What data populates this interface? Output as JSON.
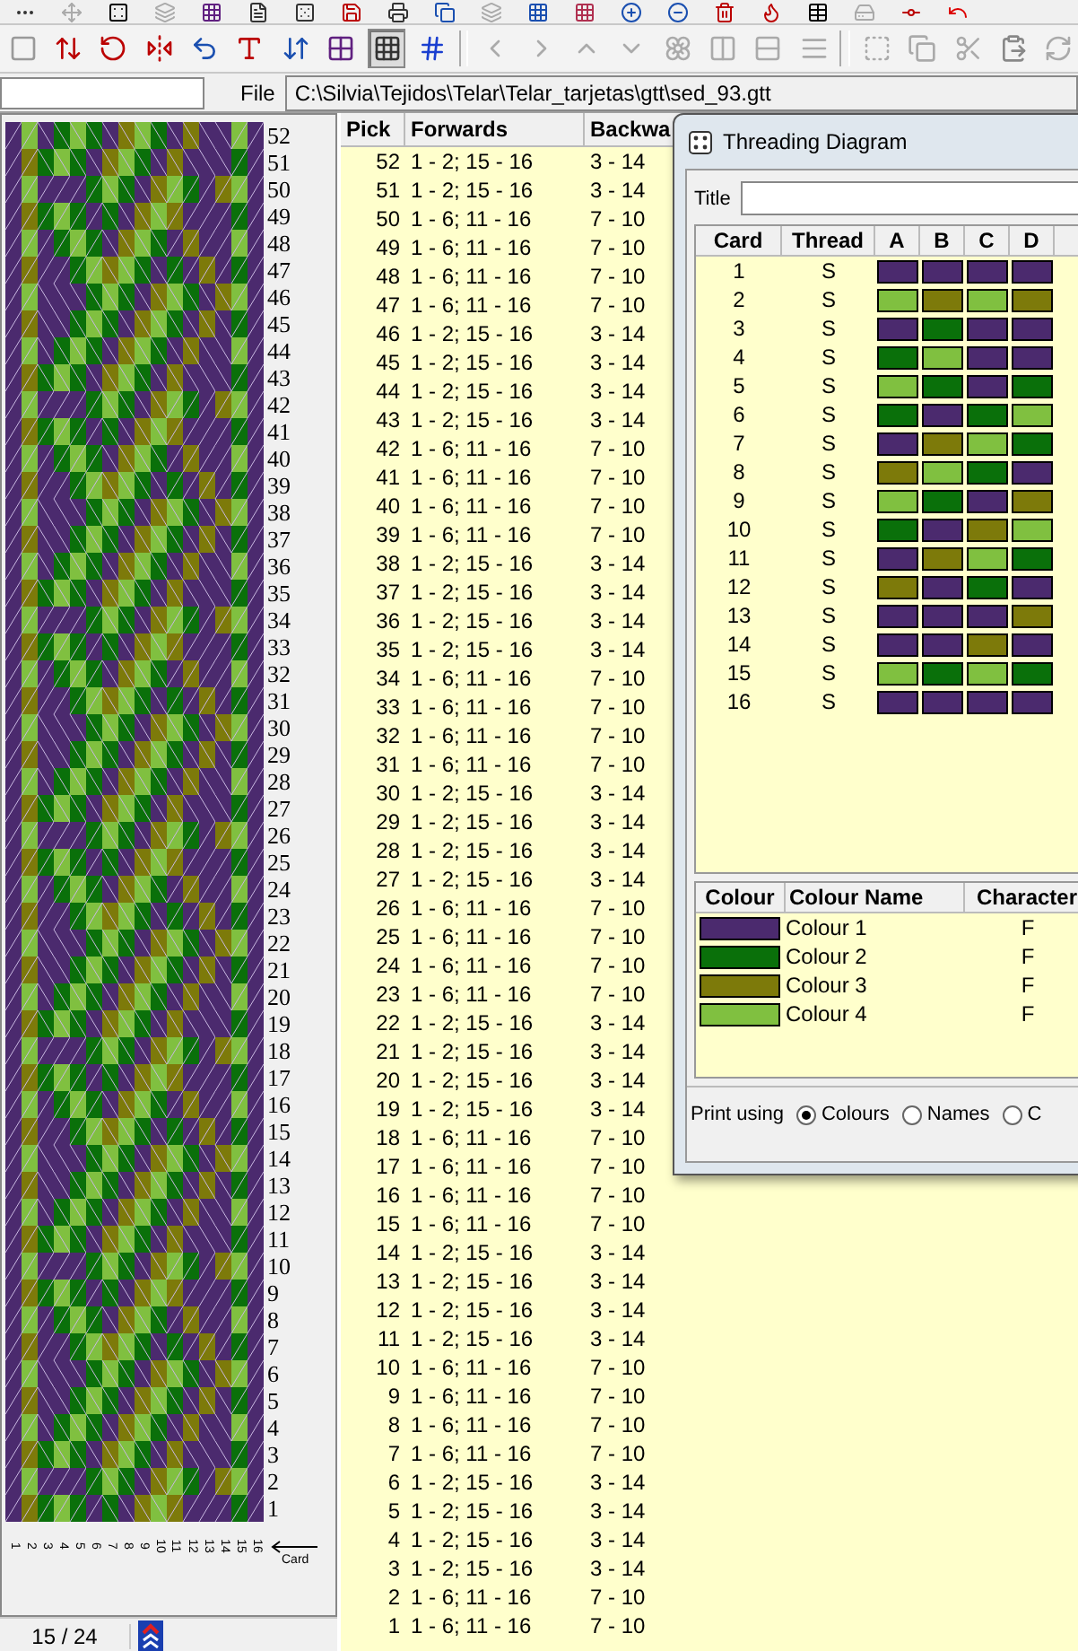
{
  "toolbar": {
    "buttons": [
      {
        "selected": false
      },
      {
        "selected": false
      },
      {
        "selected": false
      },
      {
        "selected": false
      },
      {
        "selected": false
      },
      {
        "selected": false
      },
      {
        "selected": false
      },
      {
        "selected": false
      },
      {
        "selected": true
      },
      {
        "selected": false
      },
      {
        "selected": false
      },
      {
        "selected": false
      },
      {
        "selected": false
      },
      {
        "selected": false
      },
      {
        "selected": false
      },
      {
        "selected": false
      },
      {
        "selected": false
      },
      {
        "selected": false
      },
      {
        "selected": false
      },
      {
        "selected": false
      },
      {
        "selected": false
      },
      {
        "selected": false
      },
      {
        "selected": false
      }
    ]
  },
  "file_bar": {
    "label": "File",
    "path": "C:\\Silvia\\Tejidos\\Telar\\Telar_tarjetas\\gtt\\sed_93.gtt"
  },
  "draft": {
    "row_numbers": [
      "52",
      "51",
      "50",
      "49",
      "48",
      "47",
      "46",
      "45",
      "44",
      "43",
      "42",
      "41",
      "40",
      "39",
      "38",
      "37",
      "36",
      "35",
      "34",
      "33",
      "32",
      "31",
      "30",
      "29",
      "28",
      "27",
      "26",
      "25",
      "24",
      "23",
      "22",
      "21",
      "20",
      "19",
      "18",
      "17",
      "16",
      "15",
      "14",
      "13",
      "12",
      "11",
      "10",
      "9",
      "8",
      "7",
      "6",
      "5",
      "4",
      "3",
      "2",
      "1"
    ],
    "card_numbers": [
      "1",
      "2",
      "3",
      "4",
      "5",
      "6",
      "7",
      "8",
      "9",
      "10",
      "11",
      "12",
      "13",
      "14",
      "15",
      "16"
    ],
    "card_label": "Card"
  },
  "status_bar": {
    "position": "15 / 24"
  },
  "picks": {
    "columns": [
      "Pick",
      "Forwards",
      "Backwa"
    ],
    "rows": [
      {
        "pick": "52",
        "forwards": "1 - 2; 15 - 16",
        "backwards": "3 - 14"
      },
      {
        "pick": "51",
        "forwards": "1 - 2; 15 - 16",
        "backwards": "3 - 14"
      },
      {
        "pick": "50",
        "forwards": "1 - 6; 11 - 16",
        "backwards": "7 - 10"
      },
      {
        "pick": "49",
        "forwards": "1 - 6; 11 - 16",
        "backwards": "7 - 10"
      },
      {
        "pick": "48",
        "forwards": "1 - 6; 11 - 16",
        "backwards": "7 - 10"
      },
      {
        "pick": "47",
        "forwards": "1 - 6; 11 - 16",
        "backwards": "7 - 10"
      },
      {
        "pick": "46",
        "forwards": "1 - 2; 15 - 16",
        "backwards": "3 - 14"
      },
      {
        "pick": "45",
        "forwards": "1 - 2; 15 - 16",
        "backwards": "3 - 14"
      },
      {
        "pick": "44",
        "forwards": "1 - 2; 15 - 16",
        "backwards": "3 - 14"
      },
      {
        "pick": "43",
        "forwards": "1 - 2; 15 - 16",
        "backwards": "3 - 14"
      },
      {
        "pick": "42",
        "forwards": "1 - 6; 11 - 16",
        "backwards": "7 - 10"
      },
      {
        "pick": "41",
        "forwards": "1 - 6; 11 - 16",
        "backwards": "7 - 10"
      },
      {
        "pick": "40",
        "forwards": "1 - 6; 11 - 16",
        "backwards": "7 - 10"
      },
      {
        "pick": "39",
        "forwards": "1 - 6; 11 - 16",
        "backwards": "7 - 10"
      },
      {
        "pick": "38",
        "forwards": "1 - 2; 15 - 16",
        "backwards": "3 - 14"
      },
      {
        "pick": "37",
        "forwards": "1 - 2; 15 - 16",
        "backwards": "3 - 14"
      },
      {
        "pick": "36",
        "forwards": "1 - 2; 15 - 16",
        "backwards": "3 - 14"
      },
      {
        "pick": "35",
        "forwards": "1 - 2; 15 - 16",
        "backwards": "3 - 14"
      },
      {
        "pick": "34",
        "forwards": "1 - 6; 11 - 16",
        "backwards": "7 - 10"
      },
      {
        "pick": "33",
        "forwards": "1 - 6; 11 - 16",
        "backwards": "7 - 10"
      },
      {
        "pick": "32",
        "forwards": "1 - 6; 11 - 16",
        "backwards": "7 - 10"
      },
      {
        "pick": "31",
        "forwards": "1 - 6; 11 - 16",
        "backwards": "7 - 10"
      },
      {
        "pick": "30",
        "forwards": "1 - 2; 15 - 16",
        "backwards": "3 - 14"
      },
      {
        "pick": "29",
        "forwards": "1 - 2; 15 - 16",
        "backwards": "3 - 14"
      },
      {
        "pick": "28",
        "forwards": "1 - 2; 15 - 16",
        "backwards": "3 - 14"
      },
      {
        "pick": "27",
        "forwards": "1 - 2; 15 - 16",
        "backwards": "3 - 14"
      },
      {
        "pick": "26",
        "forwards": "1 - 6; 11 - 16",
        "backwards": "7 - 10"
      },
      {
        "pick": "25",
        "forwards": "1 - 6; 11 - 16",
        "backwards": "7 - 10"
      },
      {
        "pick": "24",
        "forwards": "1 - 6; 11 - 16",
        "backwards": "7 - 10"
      },
      {
        "pick": "23",
        "forwards": "1 - 6; 11 - 16",
        "backwards": "7 - 10"
      },
      {
        "pick": "22",
        "forwards": "1 - 2; 15 - 16",
        "backwards": "3 - 14"
      },
      {
        "pick": "21",
        "forwards": "1 - 2; 15 - 16",
        "backwards": "3 - 14"
      },
      {
        "pick": "20",
        "forwards": "1 - 2; 15 - 16",
        "backwards": "3 - 14"
      },
      {
        "pick": "19",
        "forwards": "1 - 2; 15 - 16",
        "backwards": "3 - 14"
      },
      {
        "pick": "18",
        "forwards": "1 - 6; 11 - 16",
        "backwards": "7 - 10"
      },
      {
        "pick": "17",
        "forwards": "1 - 6; 11 - 16",
        "backwards": "7 - 10"
      },
      {
        "pick": "16",
        "forwards": "1 - 6; 11 - 16",
        "backwards": "7 - 10"
      },
      {
        "pick": "15",
        "forwards": "1 - 6; 11 - 16",
        "backwards": "7 - 10"
      },
      {
        "pick": "14",
        "forwards": "1 - 2; 15 - 16",
        "backwards": "3 - 14"
      },
      {
        "pick": "13",
        "forwards": "1 - 2; 15 - 16",
        "backwards": "3 - 14"
      },
      {
        "pick": "12",
        "forwards": "1 - 2; 15 - 16",
        "backwards": "3 - 14"
      },
      {
        "pick": "11",
        "forwards": "1 - 2; 15 - 16",
        "backwards": "3 - 14"
      },
      {
        "pick": "10",
        "forwards": "1 - 6; 11 - 16",
        "backwards": "7 - 10"
      },
      {
        "pick": "9",
        "forwards": "1 - 6; 11 - 16",
        "backwards": "7 - 10"
      },
      {
        "pick": "8",
        "forwards": "1 - 6; 11 - 16",
        "backwards": "7 - 10"
      },
      {
        "pick": "7",
        "forwards": "1 - 6; 11 - 16",
        "backwards": "7 - 10"
      },
      {
        "pick": "6",
        "forwards": "1 - 2; 15 - 16",
        "backwards": "3 - 14"
      },
      {
        "pick": "5",
        "forwards": "1 - 2; 15 - 16",
        "backwards": "3 - 14"
      },
      {
        "pick": "4",
        "forwards": "1 - 2; 15 - 16",
        "backwards": "3 - 14"
      },
      {
        "pick": "3",
        "forwards": "1 - 2; 15 - 16",
        "backwards": "3 - 14"
      },
      {
        "pick": "2",
        "forwards": "1 - 6; 11 - 16",
        "backwards": "7 - 10"
      },
      {
        "pick": "1",
        "forwards": "1 - 6; 11 - 16",
        "backwards": "7 - 10"
      }
    ]
  },
  "threading_dialog": {
    "title": "Threading Diagram",
    "title_label": "Title",
    "columns": [
      "Card",
      "Thread",
      "A",
      "B",
      "C",
      "D"
    ],
    "cards": [
      {
        "card": "1",
        "thread": "S",
        "holes": [
          {
            "color": "#4b2a6e"
          },
          {
            "color": "#4b2a6e"
          },
          {
            "color": "#4b2a6e"
          },
          {
            "color": "#4b2a6e"
          }
        ]
      },
      {
        "card": "2",
        "thread": "S",
        "holes": [
          {
            "color": "#80c040"
          },
          {
            "color": "#7d7a0a"
          },
          {
            "color": "#80c040"
          },
          {
            "color": "#7d7a0a"
          }
        ]
      },
      {
        "card": "3",
        "thread": "S",
        "holes": [
          {
            "color": "#4b2a6e"
          },
          {
            "color": "#0a700a"
          },
          {
            "color": "#4b2a6e"
          },
          {
            "color": "#4b2a6e"
          }
        ]
      },
      {
        "card": "4",
        "thread": "S",
        "holes": [
          {
            "color": "#0a700a"
          },
          {
            "color": "#80c040"
          },
          {
            "color": "#4b2a6e"
          },
          {
            "color": "#4b2a6e"
          }
        ]
      },
      {
        "card": "5",
        "thread": "S",
        "holes": [
          {
            "color": "#80c040"
          },
          {
            "color": "#0a700a"
          },
          {
            "color": "#4b2a6e"
          },
          {
            "color": "#0a700a"
          }
        ]
      },
      {
        "card": "6",
        "thread": "S",
        "holes": [
          {
            "color": "#0a700a"
          },
          {
            "color": "#4b2a6e"
          },
          {
            "color": "#0a700a"
          },
          {
            "color": "#80c040"
          }
        ]
      },
      {
        "card": "7",
        "thread": "S",
        "holes": [
          {
            "color": "#4b2a6e"
          },
          {
            "color": "#7d7a0a"
          },
          {
            "color": "#80c040"
          },
          {
            "color": "#0a700a"
          }
        ]
      },
      {
        "card": "8",
        "thread": "S",
        "holes": [
          {
            "color": "#7d7a0a"
          },
          {
            "color": "#80c040"
          },
          {
            "color": "#0a700a"
          },
          {
            "color": "#4b2a6e"
          }
        ]
      },
      {
        "card": "9",
        "thread": "S",
        "holes": [
          {
            "color": "#80c040"
          },
          {
            "color": "#0a700a"
          },
          {
            "color": "#4b2a6e"
          },
          {
            "color": "#7d7a0a"
          }
        ]
      },
      {
        "card": "10",
        "thread": "S",
        "holes": [
          {
            "color": "#0a700a"
          },
          {
            "color": "#4b2a6e"
          },
          {
            "color": "#7d7a0a"
          },
          {
            "color": "#80c040"
          }
        ]
      },
      {
        "card": "11",
        "thread": "S",
        "holes": [
          {
            "color": "#4b2a6e"
          },
          {
            "color": "#7d7a0a"
          },
          {
            "color": "#80c040"
          },
          {
            "color": "#0a700a"
          }
        ]
      },
      {
        "card": "12",
        "thread": "S",
        "holes": [
          {
            "color": "#7d7a0a"
          },
          {
            "color": "#4b2a6e"
          },
          {
            "color": "#0a700a"
          },
          {
            "color": "#4b2a6e"
          }
        ]
      },
      {
        "card": "13",
        "thread": "S",
        "holes": [
          {
            "color": "#4b2a6e"
          },
          {
            "color": "#4b2a6e"
          },
          {
            "color": "#4b2a6e"
          },
          {
            "color": "#7d7a0a"
          }
        ]
      },
      {
        "card": "14",
        "thread": "S",
        "holes": [
          {
            "color": "#4b2a6e"
          },
          {
            "color": "#4b2a6e"
          },
          {
            "color": "#7d7a0a"
          },
          {
            "color": "#4b2a6e"
          }
        ]
      },
      {
        "card": "15",
        "thread": "S",
        "holes": [
          {
            "color": "#80c040"
          },
          {
            "color": "#0a700a"
          },
          {
            "color": "#80c040"
          },
          {
            "color": "#0a700a"
          }
        ]
      },
      {
        "card": "16",
        "thread": "S",
        "holes": [
          {
            "color": "#4b2a6e"
          },
          {
            "color": "#4b2a6e"
          },
          {
            "color": "#4b2a6e"
          },
          {
            "color": "#4b2a6e"
          }
        ]
      }
    ],
    "colour_columns": [
      "Colour",
      "Colour Name",
      "Character"
    ],
    "colours": [
      {
        "color": "#4b2a6e",
        "name": "Colour 1",
        "character": "F"
      },
      {
        "color": "#0a700a",
        "name": "Colour 2",
        "character": "F"
      },
      {
        "color": "#7d7a0a",
        "name": "Colour 3",
        "character": "F"
      },
      {
        "color": "#80c040",
        "name": "Colour 4",
        "character": "F"
      }
    ],
    "print_label": "Print using",
    "print_options": [
      {
        "label": "Colours",
        "selected": true
      },
      {
        "label": "Names",
        "selected": false
      },
      {
        "label": "C",
        "selected": false
      }
    ]
  }
}
